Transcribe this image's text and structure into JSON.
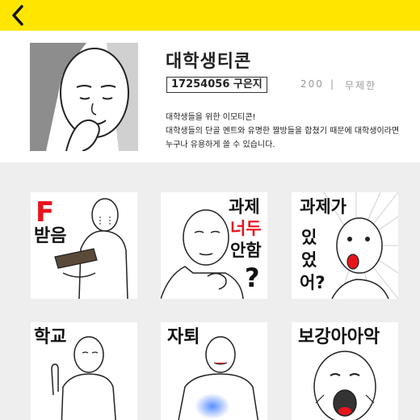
{
  "nav": {
    "back_icon": "chevron-left-icon"
  },
  "colors": {
    "topbar": "#ffe600",
    "grid_bg": "#eeeeee",
    "accent_red": "#e8141c"
  },
  "product": {
    "title": "대학생티콘",
    "author": "17254056 구은지",
    "count": "200",
    "separator": "|",
    "limit": "무제한",
    "description": [
      "대학생들을 위한 이모티콘!",
      "대학생들의 단골 멘트와 유명한 짤방들을 합쳤기 때문에 대학생이라면",
      "누구나 유용하게 쓸 수 있습니다."
    ]
  },
  "stickers": [
    {
      "lines": [
        "F",
        "받음"
      ]
    },
    {
      "lines": [
        "과제",
        "너두",
        "안함",
        "?"
      ]
    },
    {
      "lines": [
        "과제가",
        "있",
        "었",
        "어?"
      ]
    },
    {
      "lines": [
        "학교"
      ]
    },
    {
      "lines": [
        "자퇴"
      ]
    },
    {
      "lines": [
        "보강아아악"
      ]
    }
  ]
}
